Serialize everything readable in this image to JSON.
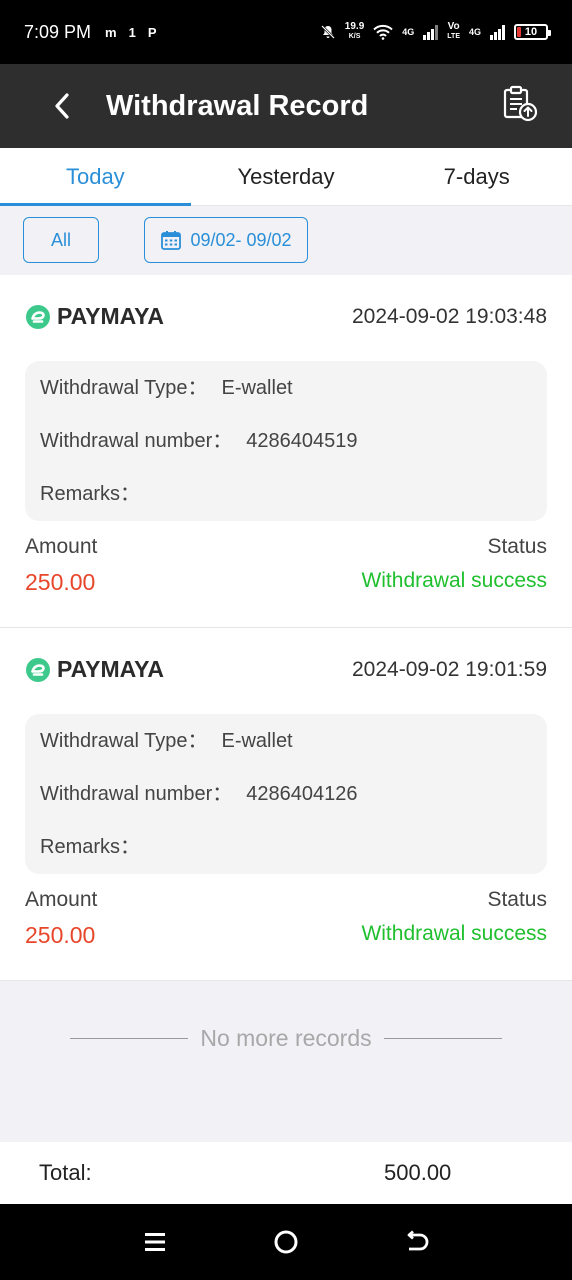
{
  "status_bar": {
    "time": "7:09 PM",
    "left_icons": [
      "m",
      "1",
      "P"
    ],
    "speed_value": "19.9",
    "speed_unit": "K/S",
    "net1": "4G",
    "volte_top": "Vo",
    "volte_bottom": "LTE",
    "net2": "4G",
    "battery": "10"
  },
  "header": {
    "title": "Withdrawal Record",
    "back_icon": "chevron-left-icon",
    "record_icon": "clipboard-upload-icon"
  },
  "tabs": [
    {
      "label": "Today",
      "active": true
    },
    {
      "label": "Yesterday",
      "active": false
    },
    {
      "label": "7-days",
      "active": false
    }
  ],
  "filters": {
    "all_label": "All",
    "date_range": "09/02- 09/02",
    "calendar_icon": "calendar-icon"
  },
  "records": [
    {
      "provider": "PAYMAYA",
      "datetime": "2024-09-02 19:03:48",
      "type_label": "Withdrawal Type：",
      "type_value": "E-wallet",
      "number_label": "Withdrawal number：",
      "number_value": "4286404519",
      "remarks_label": "Remarks：",
      "remarks_value": "",
      "amount_label": "Amount",
      "amount_value": "250.00",
      "status_label": "Status",
      "status_value": "Withdrawal success"
    },
    {
      "provider": "PAYMAYA",
      "datetime": "2024-09-02 19:01:59",
      "type_label": "Withdrawal Type：",
      "type_value": "E-wallet",
      "number_label": "Withdrawal number：",
      "number_value": "4286404126",
      "remarks_label": "Remarks：",
      "remarks_value": "",
      "amount_label": "Amount",
      "amount_value": "250.00",
      "status_label": "Status",
      "status_value": "Withdrawal success"
    }
  ],
  "no_more_text": "No more records",
  "total": {
    "label": "Total:",
    "value": "500.00"
  },
  "colors": {
    "accent": "#2a8fd8",
    "amount": "#e8462a",
    "success": "#1fbf2e",
    "header_bg": "#2e2e2e",
    "paymaya_green": "#3ec98c"
  }
}
